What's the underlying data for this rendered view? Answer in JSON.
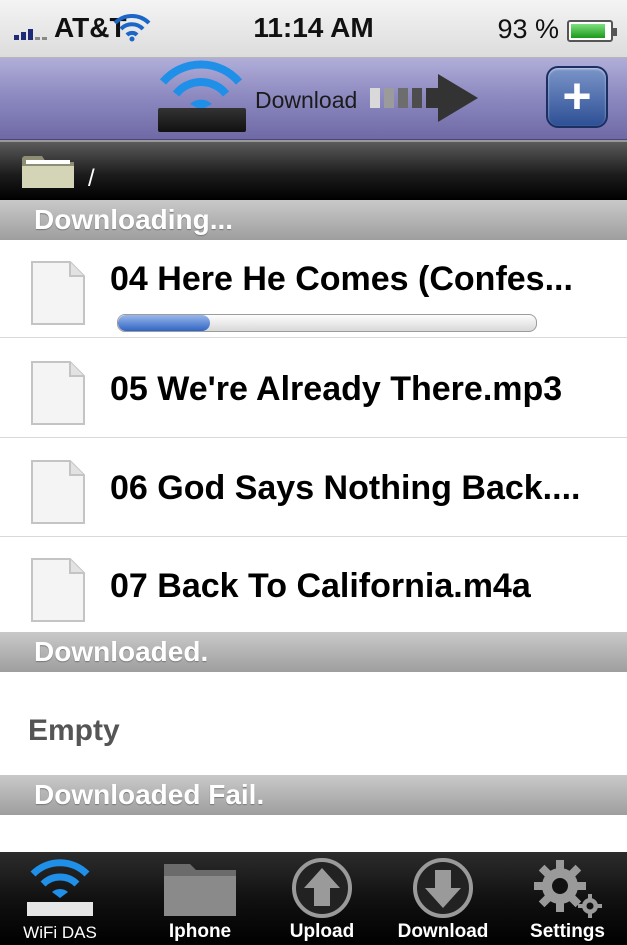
{
  "status_bar": {
    "carrier": "AT&T",
    "time": "11:14 AM",
    "battery_percent": "93 %"
  },
  "nav_bar": {
    "title": "Download",
    "add_button_label": "+"
  },
  "path_bar": {
    "path": "/"
  },
  "sections": {
    "downloading": {
      "header": "Downloading...",
      "items": [
        {
          "name": "04 Here He Comes (Confes...",
          "progress": 0.22
        },
        {
          "name": "05 We're Already There.mp3"
        },
        {
          "name": "06 God Says Nothing Back...."
        },
        {
          "name": "07 Back To California.m4a"
        }
      ]
    },
    "downloaded": {
      "header": "Downloaded.",
      "empty_text": "Empty"
    },
    "failed": {
      "header": "Downloaded Fail."
    }
  },
  "tab_bar": {
    "tabs": [
      {
        "label": "WiFi DAS",
        "icon": "wifi-device-icon"
      },
      {
        "label": "Iphone",
        "icon": "folder-icon"
      },
      {
        "label": "Upload",
        "icon": "upload-icon"
      },
      {
        "label": "Download",
        "icon": "download-icon"
      },
      {
        "label": "Settings",
        "icon": "gear-icon"
      }
    ]
  },
  "colors": {
    "nav_bar": "#8b87bf",
    "progress": "#2f65c4",
    "section_header": "#aaaaaa",
    "tab_bar": "#111111"
  }
}
